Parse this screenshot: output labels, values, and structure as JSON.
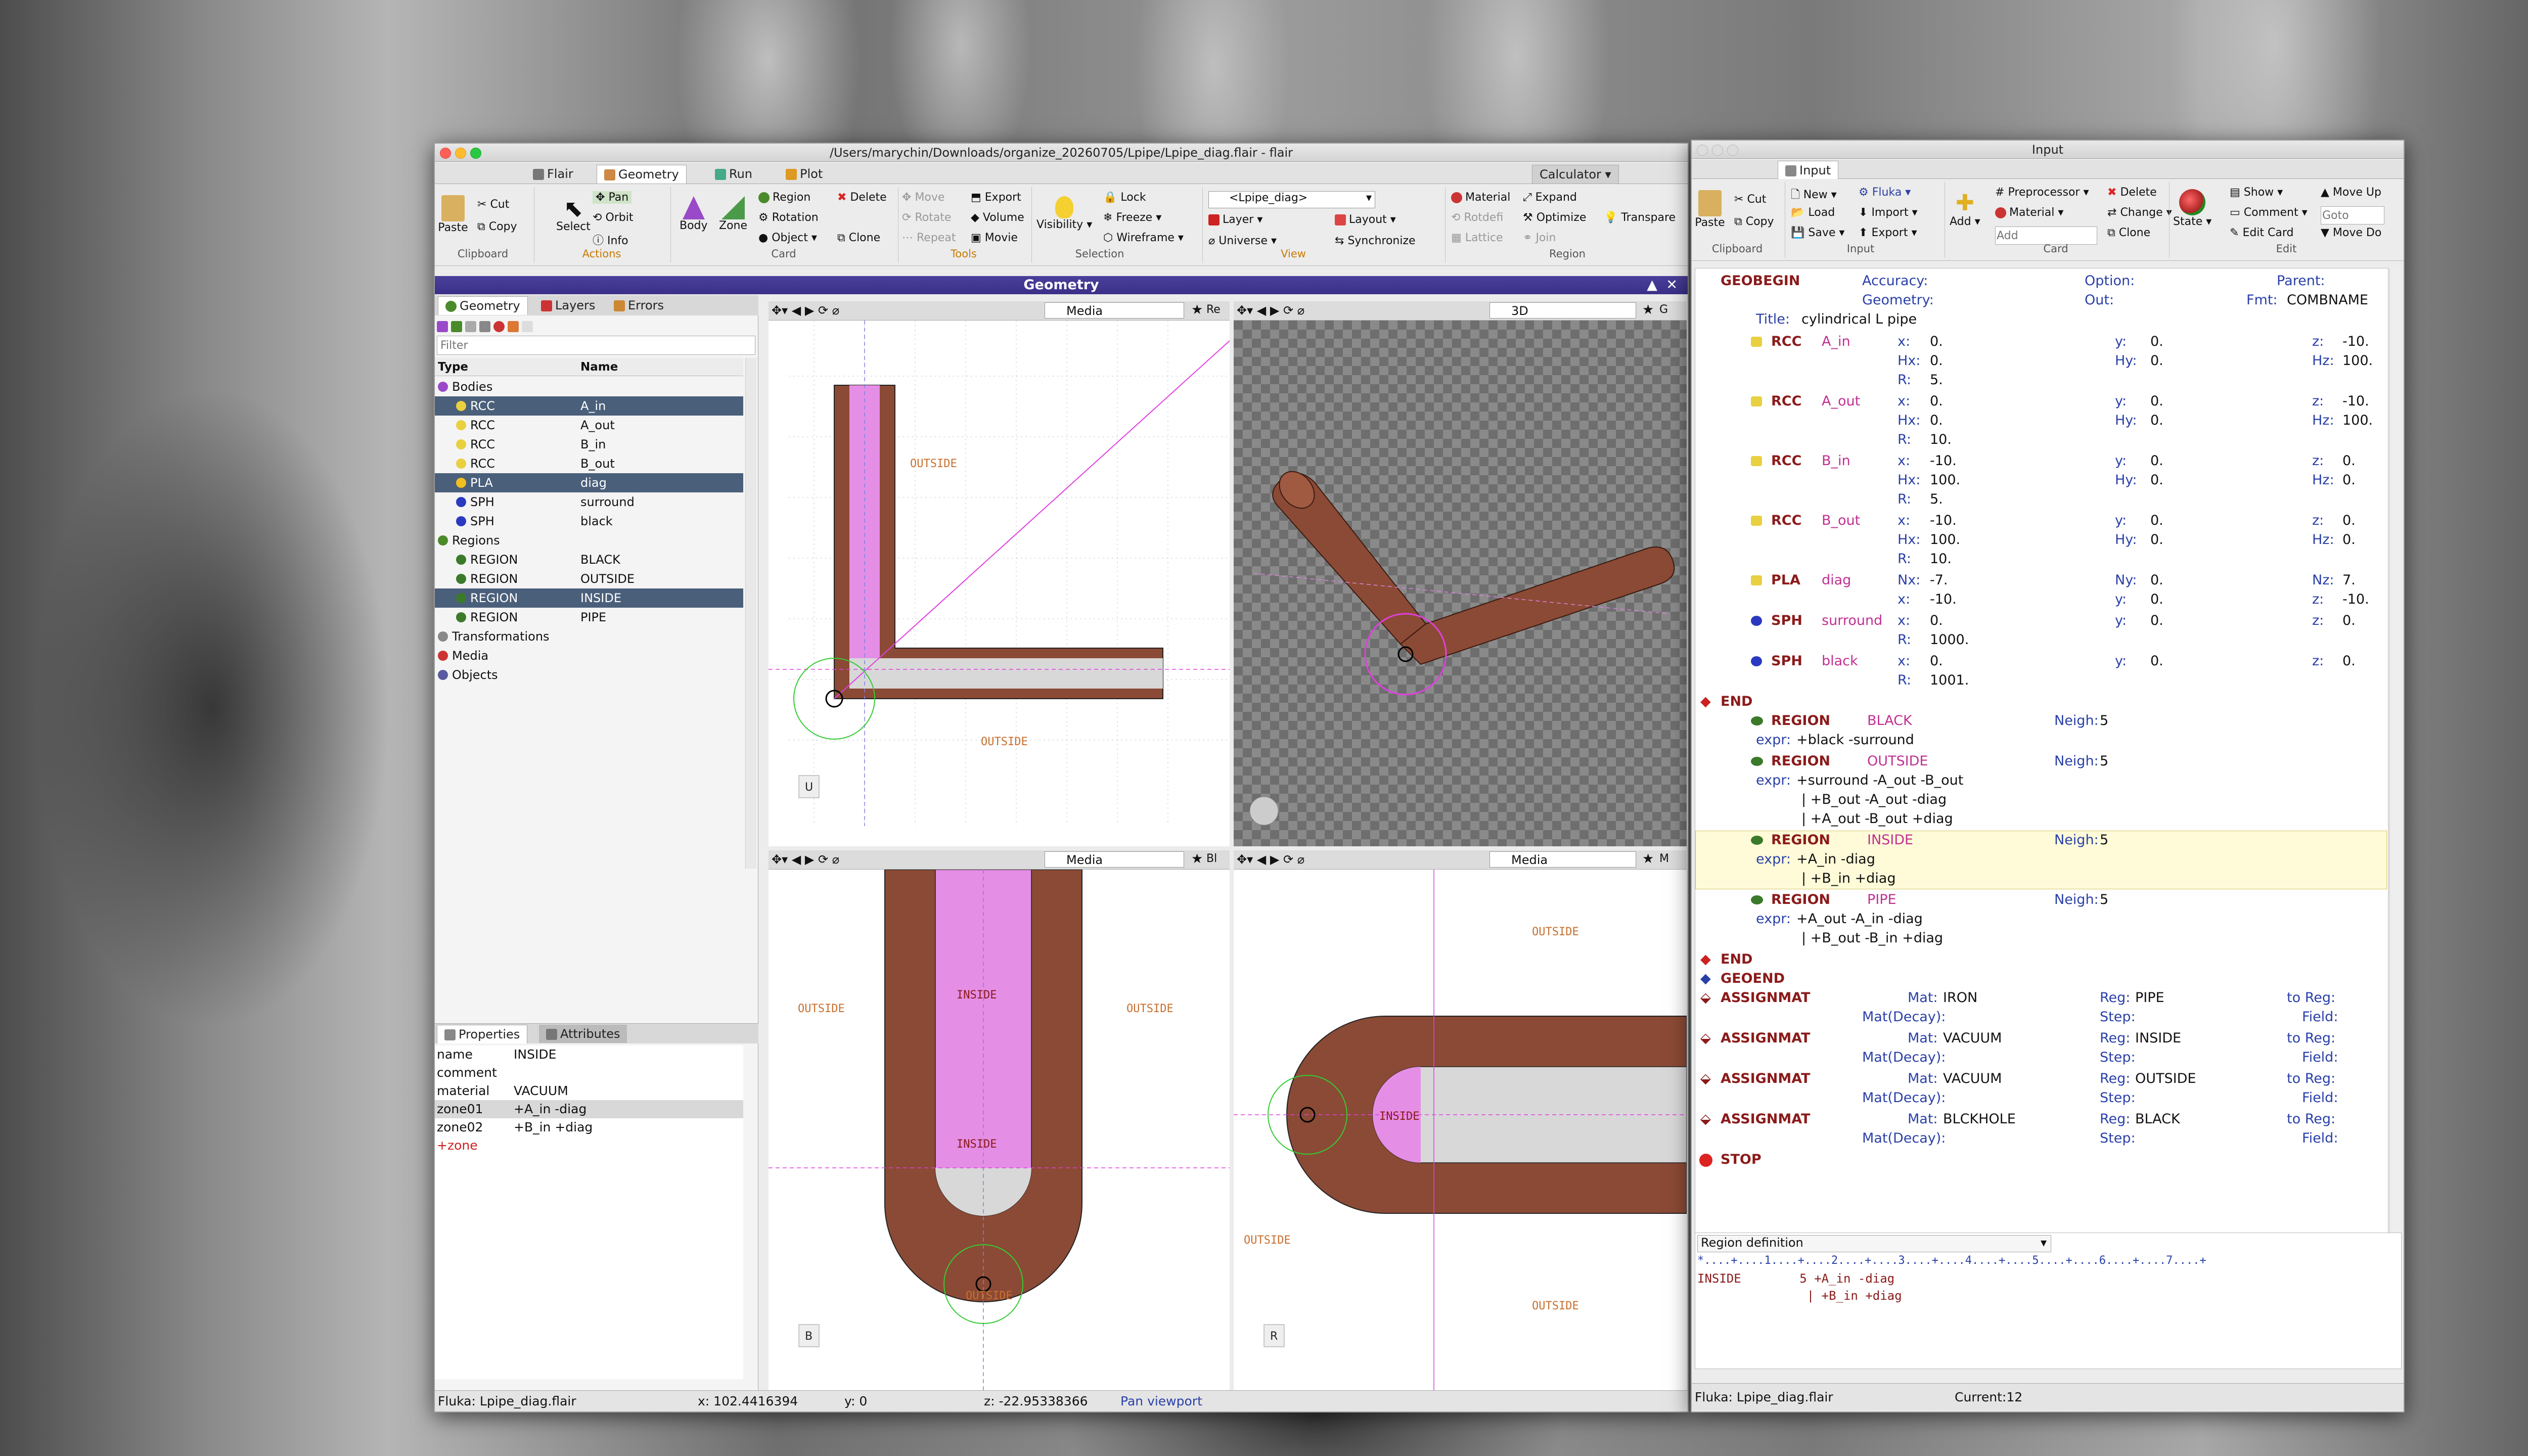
{
  "main_window": {
    "title": "/Users/marychin/Downloads/organize_20260705/Lpipe/Lpipe_diag.flair - flair",
    "tabs": [
      "Flair",
      "Geometry",
      "Run",
      "Plot"
    ],
    "calculator": "Calculator",
    "ribbon": {
      "clipboard": {
        "paste": "Paste",
        "cut": "Cut",
        "copy": "Copy",
        "label": "Clipboard"
      },
      "actions": {
        "select": "Select",
        "pan": "Pan",
        "orbit": "Orbit",
        "info": "Info",
        "label": "Actions"
      },
      "tools": {
        "body": "Body",
        "zone": "Zone",
        "region": "Region",
        "rotation": "Rotation",
        "object": "Object",
        "delete": "Delete",
        "clone": "Clone",
        "move": "Move",
        "rotate": "Rotate",
        "repeat": "Repeat",
        "export": "Export",
        "volume": "Volume",
        "movie": "Movie",
        "card_label": "Card",
        "tools_label": "Tools"
      },
      "selection": {
        "visibility": "Visibility",
        "lock": "Lock",
        "freeze": "Freeze",
        "wireframe": "Wireframe",
        "label": "Selection"
      },
      "view": {
        "combo": "<Lpipe_diag>",
        "layer": "Layer",
        "layout": "Layout",
        "universe": "Universe",
        "synchronize": "Synchronize",
        "label": "View"
      },
      "region": {
        "material": "Material",
        "expand": "Expand",
        "rotdefi": "Rotdefi",
        "optimize": "Optimize",
        "transparency": "Transpare",
        "lattice": "Lattice",
        "join": "Join",
        "label": "Region"
      }
    },
    "geometry_bar": "Geometry",
    "left_tabs": [
      "Geometry",
      "Layers",
      "Errors"
    ],
    "filter_placeholder": "Filter",
    "tree_headers": [
      "Type",
      "Name"
    ],
    "tree": [
      {
        "type": "Bodies",
        "name": "",
        "indent": 0
      },
      {
        "type": "RCC",
        "name": "A_in",
        "indent": 2,
        "sel": true
      },
      {
        "type": "RCC",
        "name": "A_out",
        "indent": 2
      },
      {
        "type": "RCC",
        "name": "B_in",
        "indent": 2
      },
      {
        "type": "RCC",
        "name": "B_out",
        "indent": 2
      },
      {
        "type": "PLA",
        "name": "diag",
        "indent": 2,
        "sel": true
      },
      {
        "type": "SPH",
        "name": "surround",
        "indent": 2
      },
      {
        "type": "SPH",
        "name": "black",
        "indent": 2
      },
      {
        "type": "Regions",
        "name": "",
        "indent": 0
      },
      {
        "type": "REGION",
        "name": "BLACK",
        "indent": 2
      },
      {
        "type": "REGION",
        "name": "OUTSIDE",
        "indent": 2
      },
      {
        "type": "REGION",
        "name": "INSIDE",
        "indent": 2,
        "sel": true
      },
      {
        "type": "REGION",
        "name": "PIPE",
        "indent": 2
      },
      {
        "type": "Transformations",
        "name": "",
        "indent": 0
      },
      {
        "type": "Media",
        "name": "",
        "indent": 0
      },
      {
        "type": "Objects",
        "name": "",
        "indent": 0
      }
    ],
    "props_tabs": [
      "Properties",
      "Attributes"
    ],
    "props": [
      [
        "name",
        "INSIDE"
      ],
      [
        "comment",
        ""
      ],
      [
        "material",
        "VACUUM"
      ],
      [
        "zone01",
        "+A_in -diag"
      ],
      [
        "zone02",
        "+B_in +diag"
      ],
      [
        "+zone",
        ""
      ]
    ],
    "viewports": {
      "top_left": {
        "mode": "Media",
        "label_outside_1": "OUTSIDE",
        "label_outside_2": "OUTSIDE",
        "corner": "U",
        "flag": "Re"
      },
      "top_right": {
        "mode": "3D",
        "flag": "G"
      },
      "bottom_left": {
        "mode": "Media",
        "label_inside_1": "INSIDE",
        "label_inside_2": "INSIDE",
        "label_outside_1": "OUTSIDE",
        "label_outside_2": "OUTSIDE",
        "label_outside_3": "OUTSIDE",
        "corner": "B",
        "flag": "Bl"
      },
      "bottom_right": {
        "mode": "Media",
        "label_inside": "INSIDE",
        "label_outside_1": "OUTSIDE",
        "label_outside_2": "OUTSIDE",
        "label_outside_3": "OUTSIDE",
        "corner": "R",
        "flag": "M"
      }
    },
    "status": {
      "file": "Fluka: Lpipe_diag.flair",
      "x": "x: 102.4416394",
      "y": "y: 0",
      "z": "z: -22.95338366",
      "mode": "Pan viewport"
    }
  },
  "input_window": {
    "title": "Input",
    "tab": "Input",
    "ribbon": {
      "paste": "Paste",
      "cut": "Cut",
      "copy": "Copy",
      "clipboard": "Clipboard",
      "new": "New",
      "fluka": "Fluka",
      "load": "Load",
      "import": "Import",
      "save": "Save",
      "export": "Export",
      "input": "Input",
      "add": "Add",
      "preprocessor": "Preprocessor",
      "material": "Material",
      "delete": "Delete",
      "change": "Change",
      "clone": "Clone",
      "add_placeholder": "Add",
      "card": "Card",
      "state": "State",
      "show": "Show",
      "comment": "Comment",
      "goto_placeholder": "Goto",
      "edit_card": "Edit Card",
      "move_up": "Move Up",
      "move_down": "Move Do",
      "edit": "Edit"
    },
    "cards": [
      {
        "kind": "geobegin",
        "name": "GEOBEGIN",
        "accuracy": "Accuracy:",
        "option": "Option:",
        "parent": "Parent:",
        "geometry": "Geometry:",
        "out": "Out:",
        "fmt": "Fmt:",
        "fmt_val": "COMBNAME",
        "title": "Title:",
        "title_val": "cylindrical L pipe"
      },
      {
        "kind": "body",
        "type": "RCC",
        "name": "A_in",
        "rows": [
          [
            "x:",
            "0.",
            "y:",
            "0.",
            "z:",
            "-10."
          ],
          [
            "Hx:",
            "0.",
            "Hy:",
            "0.",
            "Hz:",
            "100."
          ],
          [
            "R:",
            "5.",
            "",
            "",
            "",
            ""
          ]
        ]
      },
      {
        "kind": "body",
        "type": "RCC",
        "name": "A_out",
        "rows": [
          [
            "x:",
            "0.",
            "y:",
            "0.",
            "z:",
            "-10."
          ],
          [
            "Hx:",
            "0.",
            "Hy:",
            "0.",
            "Hz:",
            "100."
          ],
          [
            "R:",
            "10.",
            "",
            "",
            "",
            ""
          ]
        ]
      },
      {
        "kind": "body",
        "type": "RCC",
        "name": "B_in",
        "rows": [
          [
            "x:",
            "-10.",
            "y:",
            "0.",
            "z:",
            "0."
          ],
          [
            "Hx:",
            "100.",
            "Hy:",
            "0.",
            "Hz:",
            "0."
          ],
          [
            "R:",
            "5.",
            "",
            "",
            "",
            ""
          ]
        ]
      },
      {
        "kind": "body",
        "type": "RCC",
        "name": "B_out",
        "rows": [
          [
            "x:",
            "-10.",
            "y:",
            "0.",
            "z:",
            "0."
          ],
          [
            "Hx:",
            "100.",
            "Hy:",
            "0.",
            "Hz:",
            "0."
          ],
          [
            "R:",
            "10.",
            "",
            "",
            "",
            ""
          ]
        ]
      },
      {
        "kind": "body",
        "type": "PLA",
        "name": "diag",
        "rows": [
          [
            "Nx:",
            "-7.",
            "Ny:",
            "0.",
            "Nz:",
            "7."
          ],
          [
            "x:",
            "-10.",
            "y:",
            "0.",
            "z:",
            "-10."
          ]
        ]
      },
      {
        "kind": "body",
        "type": "SPH",
        "name": "surround",
        "rows": [
          [
            "x:",
            "0.",
            "y:",
            "0.",
            "z:",
            "0."
          ],
          [
            "R:",
            "1000.",
            "",
            "",
            "",
            ""
          ]
        ]
      },
      {
        "kind": "body",
        "type": "SPH",
        "name": "black",
        "rows": [
          [
            "x:",
            "0.",
            "y:",
            "0.",
            "z:",
            "0."
          ],
          [
            "R:",
            "1001.",
            "",
            "",
            "",
            ""
          ]
        ]
      }
    ],
    "end1": "END",
    "regions": [
      {
        "name": "BLACK",
        "neigh": "5",
        "expr": [
          "+black -surround"
        ]
      },
      {
        "name": "OUTSIDE",
        "neigh": "5",
        "expr": [
          "+surround -A_out -B_out",
          "| +B_out -A_out -diag",
          "| +A_out -B_out +diag"
        ]
      },
      {
        "name": "INSIDE",
        "neigh": "5",
        "expr": [
          "+A_in -diag",
          "| +B_in +diag"
        ],
        "sel": true
      },
      {
        "name": "PIPE",
        "neigh": "5",
        "expr": [
          "+A_out -A_in -diag",
          "| +B_out -B_in +diag"
        ]
      }
    ],
    "region_kw": "REGION",
    "neigh_label": "Neigh:",
    "expr_label": "expr:",
    "end2": "END",
    "geoend": "GEOEND",
    "assignmat": [
      {
        "mat": "IRON",
        "reg": "PIPE"
      },
      {
        "mat": "VACUUM",
        "reg": "INSIDE"
      },
      {
        "mat": "VACUUM",
        "reg": "OUTSIDE"
      },
      {
        "mat": "BLCKHOLE",
        "reg": "BLACK"
      }
    ],
    "assign_kw": "ASSIGNMAT",
    "assign_labels": {
      "mat": "Mat:",
      "reg": "Reg:",
      "toreg": "to Reg:",
      "matdecay": "Mat(Decay):",
      "step": "Step:",
      "field": "Field:"
    },
    "stop": "STOP",
    "bottom_panel": {
      "combo": "Region definition",
      "ruler": "*....+....1....+....2....+....3....+....4....+....5....+....6....+....7....+",
      "line1": "INSIDE        5 +A_in -diag",
      "line2": "               | +B_in +diag"
    },
    "status": {
      "file": "Fluka: Lpipe_diag.flair",
      "current": "Current:12"
    }
  },
  "colors": {
    "pipe": "#8b4a35",
    "inside": "#e58ee5",
    "title_bar": "#3a2f88",
    "keyword": "#8b1a1a",
    "name": "#c03090"
  }
}
